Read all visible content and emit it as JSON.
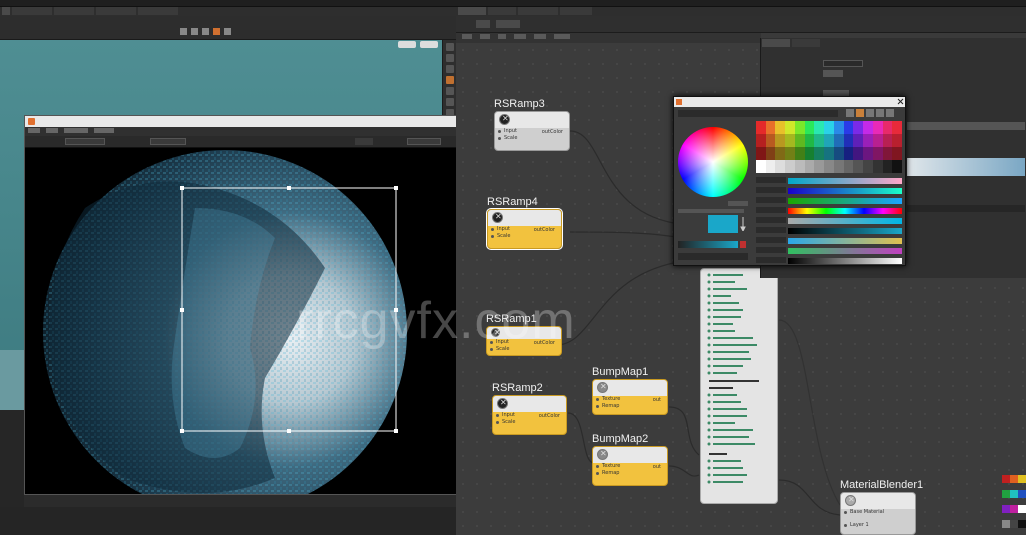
{
  "nodes": {
    "rsramp3": {
      "label": "RSRamp3",
      "in1": "Input",
      "in2": "Scale",
      "out": "outColor"
    },
    "rsramp4": {
      "label": "RSRamp4",
      "in1": "Input",
      "in2": "Scale",
      "out": "outColor"
    },
    "rsramp1": {
      "label": "RSRamp1",
      "in1": "Input",
      "in2": "Scale",
      "out": "outColor"
    },
    "rsramp2": {
      "label": "RSRamp2",
      "in1": "Input",
      "in2": "Scale",
      "out": "outColor"
    },
    "bumpmap1": {
      "label": "BumpMap1",
      "in1": "Texture",
      "in2": "Remap",
      "out": "out"
    },
    "bumpmap2": {
      "label": "BumpMap2",
      "in1": "Texture",
      "in2": "Remap",
      "out": "out"
    },
    "materialblender1": {
      "label": "MaterialBlender1",
      "in1": "Base Material",
      "in2": "Layer 1"
    }
  },
  "watermark": "rrcgvfx.com",
  "colors": {
    "node_yellow": "#f2c23e",
    "ne_bg": "#3c3c3c",
    "viewport_teal": "#4f8e93",
    "swatch_cyan": "#1aa7c9"
  }
}
